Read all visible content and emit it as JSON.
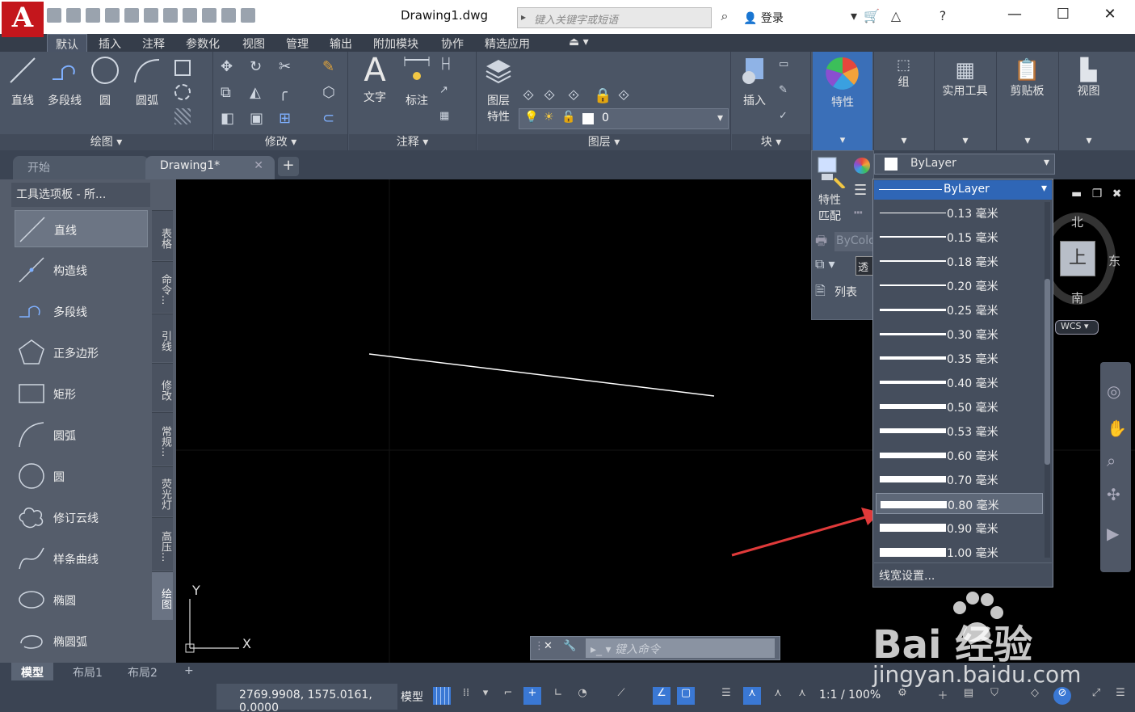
{
  "title_bar": {
    "app_letter": "A",
    "document_title": "Drawing1.dwg",
    "search_placeholder": "键入关键字或短语",
    "login_label": "登录"
  },
  "ribbon_tabs": [
    "默认",
    "插入",
    "注释",
    "参数化",
    "视图",
    "管理",
    "输出",
    "附加模块",
    "协作",
    "精选应用"
  ],
  "ribbon": {
    "draw_panel": {
      "title": "绘图 ▾",
      "line": "直线",
      "polyline": "多段线",
      "circle": "圆",
      "arc": "圆弧"
    },
    "modify_panel": {
      "title": "修改 ▾"
    },
    "annotation_panel": {
      "title": "注释 ▾",
      "text": "文字",
      "dimension": "标注"
    },
    "layers_panel": {
      "title": "图层 ▾",
      "layer_props_line1": "图层",
      "layer_props_line2": "特性",
      "current_layer": "0"
    },
    "block_panel": {
      "title": "块 ▾",
      "insert": "插入"
    },
    "properties_btn": "特性",
    "group_btn": "组",
    "utilities_btn": "实用工具",
    "clipboard_btn": "剪贴板",
    "view_btn": "视图"
  },
  "file_tabs": {
    "start": "开始",
    "doc": "Drawing1*"
  },
  "tool_palette": {
    "title": "工具选项板 - 所...",
    "tools": [
      "直线",
      "构造线",
      "多段线",
      "正多边形",
      "矩形",
      "圆弧",
      "圆",
      "修订云线",
      "样条曲线",
      "椭圆",
      "椭圆弧"
    ],
    "side_tabs": [
      "表格",
      "命令...",
      "引线",
      "修改",
      "常规...",
      "荧光灯",
      "高压...",
      "绘图"
    ]
  },
  "properties_flyout": {
    "match_line1": "特性",
    "match_line2": "匹配",
    "color_value": "ByLayer",
    "plotstyle_value": "ByColo",
    "transparency_value": "透",
    "list_label": "列表"
  },
  "lineweight_dropdown": {
    "selected": "ByLayer",
    "options": [
      "0.13 毫米",
      "0.15 毫米",
      "0.18 毫米",
      "0.20 毫米",
      "0.25 毫米",
      "0.30 毫米",
      "0.35 毫米",
      "0.40 毫米",
      "0.50 毫米",
      "0.53 毫米",
      "0.60 毫米",
      "0.70 毫米",
      "0.80 毫米",
      "0.90 毫米",
      "1.00 毫米"
    ],
    "highlighted": "0.80 毫米",
    "footer": "线宽设置..."
  },
  "viewcube": {
    "north": "北",
    "south": "南",
    "east": "东",
    "face": "上",
    "wcs": "WCS"
  },
  "command_line": {
    "placeholder": "键入命令"
  },
  "layout_tabs": [
    "模型",
    "布局1",
    "布局2"
  ],
  "status_bar": {
    "coordinates": "2769.9908, 1575.0161, 0.0000",
    "model": "模型",
    "scale": "1:1 / 100%"
  },
  "ucs": {
    "x": "X",
    "y": "Y"
  },
  "watermark": {
    "brand": "Bai 经验",
    "url": "jingyan.baidu.com"
  },
  "colors": {
    "accent": "#3a6fb8",
    "ribbon_bg": "#4b5565",
    "canvas": "#000000",
    "arrow": "#e03a3a"
  }
}
